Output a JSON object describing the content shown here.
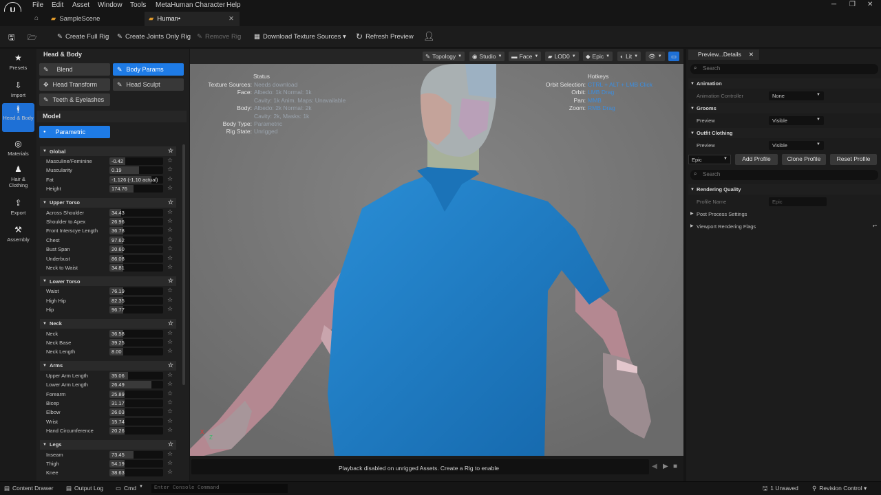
{
  "menu": [
    "File",
    "Edit",
    "Asset",
    "Window",
    "Tools",
    "MetaHuman Character",
    "Help"
  ],
  "tabs": {
    "scene": "SampleScene",
    "asset": "Human•"
  },
  "toolbar": {
    "create_full_rig": "Create Full Rig",
    "create_joints": "Create Joints Only Rig",
    "remove_rig": "Remove Rig",
    "download_textures": "Download Texture Sources ▾",
    "refresh_preview": "Refresh Preview"
  },
  "nav": [
    "Presets",
    "Import",
    "Head & Body",
    "Materials",
    "Hair & Clothing",
    "Export",
    "Assembly"
  ],
  "panel": {
    "title": "Head & Body",
    "buttons": [
      "Blend",
      "Body Params",
      "Head Transform",
      "Head Sculpt",
      "Teeth & Eyelashes"
    ],
    "model_header": "Model",
    "model_button": "Parametric",
    "sections": [
      {
        "name": "Global",
        "rows": [
          [
            "Masculine/Feminine",
            "-0.42",
            0.29
          ],
          [
            "Muscularity",
            "0.19",
            0.55
          ],
          [
            "Fat",
            "-1.126 (-1.10 actual)",
            0.78
          ],
          [
            "Height",
            "174.76",
            0.45
          ]
        ]
      },
      {
        "name": "Upper Torso",
        "rows": [
          [
            "Across Shoulder",
            "34.43",
            0.22
          ],
          [
            "Shoulder to Apex",
            "26.96",
            0.25
          ],
          [
            "Front Interscye Length",
            "36.78",
            0.25
          ],
          [
            "Chest",
            "97.62",
            0.25
          ],
          [
            "Bust Span",
            "20.60",
            0.25
          ],
          [
            "Underbust",
            "86.08",
            0.25
          ],
          [
            "Neck to Waist",
            "34.81",
            0.25
          ]
        ]
      },
      {
        "name": "Lower Torso",
        "rows": [
          [
            "Waist",
            "76.19",
            0.25
          ],
          [
            "High Hip",
            "82.35",
            0.25
          ],
          [
            "Hip",
            "96.77",
            0.25
          ]
        ]
      },
      {
        "name": "Neck",
        "rows": [
          [
            "Neck",
            "36.58",
            0.25
          ],
          [
            "Neck Base",
            "39.25",
            0.25
          ],
          [
            "Neck Length",
            "8.00",
            0.25
          ]
        ]
      },
      {
        "name": "Arms",
        "rows": [
          [
            "Upper Arm Length",
            "35.06",
            0.35
          ],
          [
            "Lower Arm Length",
            "26.49",
            0.78
          ],
          [
            "Forearm",
            "25.89",
            0.28
          ],
          [
            "Bicep",
            "31.17",
            0.28
          ],
          [
            "Elbow",
            "26.03",
            0.28
          ],
          [
            "Wrist",
            "15.74",
            0.28
          ],
          [
            "Hand Circumference",
            "20.26",
            0.28
          ]
        ]
      },
      {
        "name": "Legs",
        "rows": [
          [
            "Inseam",
            "73.45",
            0.45
          ],
          [
            "Thigh",
            "54.19",
            0.28
          ],
          [
            "Knee",
            "38.63",
            0.28
          ]
        ]
      }
    ]
  },
  "viewport_toolbar": [
    "Topology",
    "Studio",
    "Face",
    "LOD0",
    "Epic",
    "Lit"
  ],
  "overlay": {
    "status_title": "Status",
    "hotkeys_title": "Hotkeys",
    "status_rows": [
      [
        "Texture Sources:",
        "Needs download"
      ],
      [
        "Face:",
        "Albedo: 1k Normal: 1k"
      ],
      [
        "",
        "Cavity: 1k Anim. Maps: Unavailable"
      ],
      [
        "Body:",
        "Albedo: 2k Normal: 2k"
      ],
      [
        "",
        "Cavity: 2k, Masks: 1k"
      ],
      [
        "Body Type:",
        "Parametric"
      ],
      [
        "Rig State:",
        "Unrigged"
      ]
    ],
    "hotkey_rows": [
      [
        "Orbit Selection:",
        "CTRL + ALT + LMB Click"
      ],
      [
        "Orbit:",
        "LMB Drag"
      ],
      [
        "Pan:",
        "MMB"
      ],
      [
        "Zoom:",
        "RMB Drag"
      ]
    ]
  },
  "playback_msg": "Playback disabled on unrigged Assets. Create a Rig to enable",
  "right": {
    "tab": "Preview...Details",
    "search": "Search",
    "animation": "Animation",
    "anim_controller": "Animation Controller",
    "anim_value": "None",
    "grooms": "Grooms",
    "grooms_preview": "Preview",
    "grooms_value": "Visible",
    "outfit": "Outfit Clothing",
    "outfit_preview": "Preview",
    "outfit_value": "Visible",
    "profile_value": "Epic",
    "add_profile": "Add Profile",
    "clone_profile": "Clone Profile",
    "reset_profile": "Reset Profile",
    "search2": "Search",
    "rendering": "Rendering Quality",
    "profile_name": "Profile Name",
    "profile_name_value": "Epic",
    "post_process": "Post Process Settings",
    "viewport_flags": "Viewport Rendering Flags"
  },
  "status": {
    "content_drawer": "Content Drawer",
    "output_log": "Output Log",
    "cmd": "Cmd",
    "console_placeholder": "Enter Console Command",
    "unsaved": "1 Unsaved",
    "revision": "Revision Control ▾"
  },
  "colors": {
    "accent": "#1e7be6",
    "shirt": "#1e7fc9",
    "skin": "#b08890"
  }
}
